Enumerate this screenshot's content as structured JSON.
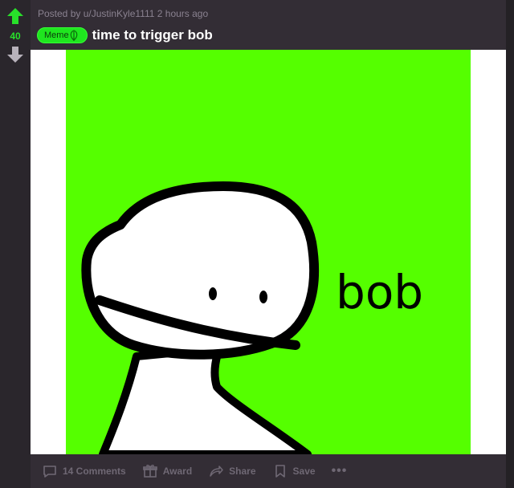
{
  "post": {
    "score": "40",
    "meta": "Posted by u/JustinKyle1111 2 hours ago",
    "flair": "Meme",
    "title": "time to trigger bob",
    "image": {
      "text": "bob",
      "background_color": "#55ff00"
    }
  },
  "actions": {
    "comments": "14 Comments",
    "award": "Award",
    "share": "Share",
    "save": "Save",
    "more": "•••"
  },
  "colors": {
    "upvote": "#28e02a",
    "downvote": "#b8b2bb",
    "flair_bg": "#1fe61f",
    "card_bg": "#332d35"
  },
  "icons": {
    "upvote": "upvote-arrow-icon",
    "downvote": "downvote-arrow-icon",
    "comments": "comment-bubble-icon",
    "award": "gift-icon",
    "share": "share-arrow-icon",
    "save": "bookmark-icon"
  }
}
